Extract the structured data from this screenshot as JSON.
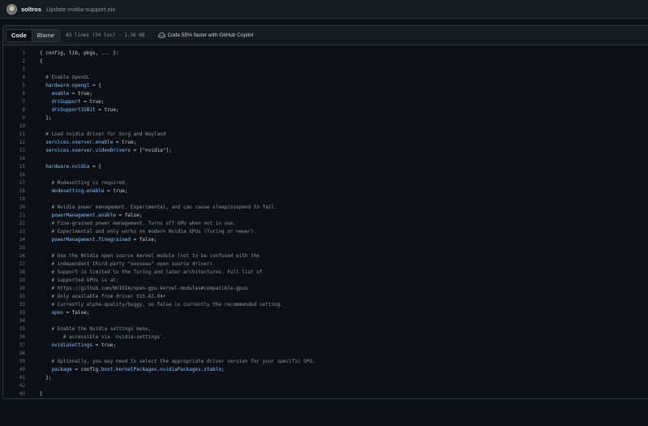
{
  "commit": {
    "author": "soltros",
    "message": "Update nvidia-support.nix"
  },
  "toolbar": {
    "code_label": "Code",
    "blame_label": "Blame",
    "file_info": "43 lines (34 loc) · 1.36 KB",
    "copilot_label": "Code 55% faster with GitHub Copilot"
  },
  "code_lines": [
    [
      [
        "t",
        "{ config, lib, pkgs, ... }:"
      ]
    ],
    [
      [
        "t",
        "{"
      ]
    ],
    [],
    [
      [
        "c",
        "  # Enable OpenGL"
      ]
    ],
    [
      [
        "a",
        "  hardware.opengl"
      ],
      [
        "t",
        " = {"
      ]
    ],
    [
      [
        "a",
        "    enable"
      ],
      [
        "t",
        " = true;"
      ]
    ],
    [
      [
        "a",
        "    driSupport"
      ],
      [
        "t",
        " = true;"
      ]
    ],
    [
      [
        "a",
        "    driSupport32Bit"
      ],
      [
        "t",
        " = true;"
      ]
    ],
    [
      [
        "t",
        "  };"
      ]
    ],
    [],
    [
      [
        "c",
        "  # Load nvidia driver for Xorg and Wayland"
      ]
    ],
    [
      [
        "a",
        "  services.xserver.enable"
      ],
      [
        "t",
        " = true;"
      ]
    ],
    [
      [
        "a",
        "  services.xserver.videoDrivers"
      ],
      [
        "t",
        " = ["
      ],
      [
        "s",
        "\"nvidia\""
      ],
      [
        "t",
        "];"
      ]
    ],
    [],
    [
      [
        "a",
        "  hardware.nvidia"
      ],
      [
        "t",
        " = {"
      ]
    ],
    [],
    [
      [
        "c",
        "    # Modesetting is required."
      ]
    ],
    [
      [
        "a",
        "    modesetting.enable"
      ],
      [
        "t",
        " = true;"
      ]
    ],
    [],
    [
      [
        "c",
        "    # Nvidia power management. Experimental, and can cause sleep/suspend to fail."
      ]
    ],
    [
      [
        "a",
        "    powerManagement.enable"
      ],
      [
        "t",
        " = false;"
      ]
    ],
    [
      [
        "c",
        "    # Fine-grained power management. Turns off GPU when not in use."
      ]
    ],
    [
      [
        "c",
        "    # Experimental and only works on modern Nvidia GPUs (Turing or newer)."
      ]
    ],
    [
      [
        "a",
        "    powerManagement.finegrained"
      ],
      [
        "t",
        " = false;"
      ]
    ],
    [],
    [
      [
        "c",
        "    # Use the NVidia open source kernel module (not to be confused with the"
      ]
    ],
    [
      [
        "c",
        "    # independent third-party \"nouveau\" open source driver)."
      ]
    ],
    [
      [
        "c",
        "    # Support is limited to the Turing and later architectures. Full list of"
      ]
    ],
    [
      [
        "c",
        "    # supported GPUs is at:"
      ]
    ],
    [
      [
        "c",
        "    # https://github.com/NVIDIA/open-gpu-kernel-modules#compatible-gpus"
      ]
    ],
    [
      [
        "c",
        "    # Only available from driver 515.43.04+"
      ]
    ],
    [
      [
        "c",
        "    # Currently alpha-quality/buggy, so false is currently the recommended setting."
      ]
    ],
    [
      [
        "a",
        "    open"
      ],
      [
        "t",
        " = false;"
      ]
    ],
    [],
    [
      [
        "c",
        "    # Enable the Nvidia settings menu,"
      ]
    ],
    [
      [
        "c",
        "        # accessible via `nvidia-settings`."
      ]
    ],
    [
      [
        "a",
        "    nvidiaSettings"
      ],
      [
        "t",
        " = true;"
      ]
    ],
    [],
    [
      [
        "c",
        "    # Optionally, you may need to select the appropriate driver version for your specific GPU."
      ]
    ],
    [
      [
        "a",
        "    package"
      ],
      [
        "t",
        " = config."
      ],
      [
        "a",
        "boot.kernelPackages.nvidiaPackages.stable"
      ],
      [
        "t",
        ";"
      ]
    ],
    [
      [
        "t",
        "  };"
      ]
    ],
    [],
    [
      [
        "t",
        "}"
      ]
    ]
  ]
}
